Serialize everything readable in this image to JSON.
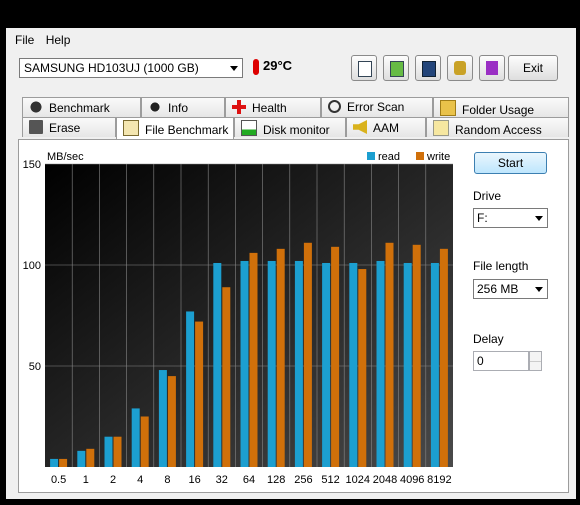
{
  "menu": [
    "File",
    "Help"
  ],
  "drive_select": {
    "value": "SAMSUNG HD103UJ (1000 GB)"
  },
  "temperature": "29°C",
  "toolbar": {
    "exit_label": "Exit"
  },
  "tabs_row1": [
    {
      "label": "Benchmark",
      "icon": "bomb-icon"
    },
    {
      "label": "Info",
      "icon": "info-icon"
    },
    {
      "label": "Health",
      "icon": "health-cross-icon"
    },
    {
      "label": "Error Scan",
      "icon": "magnifier-icon"
    },
    {
      "label": "Folder Usage",
      "icon": "folder-icon"
    }
  ],
  "tabs_row2": [
    {
      "label": "Erase",
      "icon": "trash-icon"
    },
    {
      "label": "File Benchmark",
      "icon": "clipboard-icon",
      "active": true
    },
    {
      "label": "Disk monitor",
      "icon": "chart-icon"
    },
    {
      "label": "AAM",
      "icon": "speaker-icon"
    },
    {
      "label": "Random Access",
      "icon": "scatter-icon"
    }
  ],
  "right_panel": {
    "start_label": "Start",
    "drive_label": "Drive",
    "drive_value": "F:",
    "file_length_label": "File length",
    "file_length_value": "256 MB",
    "delay_label": "Delay",
    "delay_value": "0"
  },
  "colors": {
    "read": "#1c9fd0",
    "write": "#d0700a"
  },
  "chart_data": {
    "type": "bar",
    "ylabel": "MB/sec",
    "ylim": [
      0,
      150
    ],
    "yticks": [
      50,
      100,
      150
    ],
    "categories": [
      "0.5",
      "1",
      "2",
      "4",
      "8",
      "16",
      "32",
      "64",
      "128",
      "256",
      "512",
      "1024",
      "2048",
      "4096",
      "8192"
    ],
    "series": [
      {
        "name": "read",
        "values": [
          4,
          8,
          15,
          29,
          48,
          77,
          101,
          102,
          102,
          102,
          101,
          101,
          102,
          101,
          101
        ]
      },
      {
        "name": "write",
        "values": [
          4,
          9,
          15,
          25,
          45,
          72,
          89,
          106,
          108,
          111,
          109,
          98,
          111,
          110,
          108
        ]
      }
    ]
  }
}
